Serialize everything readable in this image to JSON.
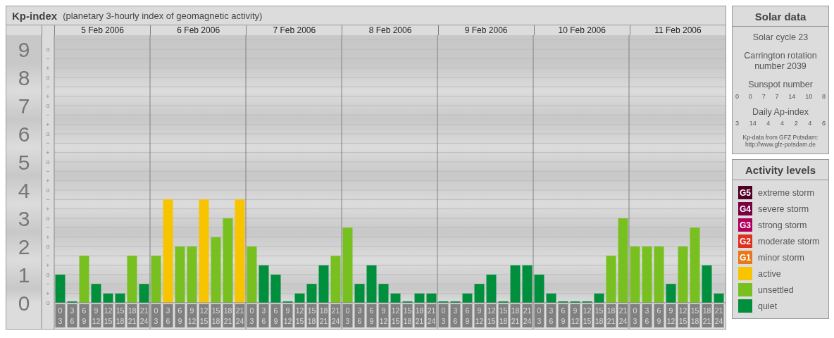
{
  "kp_panel": {
    "title": "Kp-index",
    "subtitle": "(planetary 3-hourly index of geomagnetic activity)",
    "days": [
      "5 Feb 2006",
      "6 Feb 2006",
      "7 Feb 2006",
      "8 Feb 2006",
      "9 Feb 2006",
      "10 Feb 2006",
      "11 Feb 2006"
    ],
    "sub_ticks": [
      "o",
      "−",
      "+",
      "o",
      "−",
      "+",
      "o",
      "−",
      "+",
      "o",
      "−",
      "+",
      "o",
      "−",
      "+",
      "o",
      "−",
      "+",
      "o",
      "−",
      "+",
      "o",
      "−",
      "+",
      "o",
      "−",
      "+",
      "o"
    ],
    "chart_data": {
      "type": "bar",
      "grid": true,
      "categories": [
        "0 3",
        "3 6",
        "6 9",
        "9 12",
        "12 15",
        "15 18",
        "18 21",
        "21 24",
        "0 3",
        "3 6",
        "6 9",
        "9 12",
        "12 15",
        "15 18",
        "18 21",
        "21 24",
        "0 3",
        "3 6",
        "6 9",
        "9 12",
        "12 15",
        "15 18",
        "18 21",
        "21 24",
        "0 3",
        "3 6",
        "6 9",
        "9 12",
        "12 15",
        "15 18",
        "18 21",
        "21 24",
        "0 3",
        "3 6",
        "6 9",
        "9 12",
        "12 15",
        "15 18",
        "18 21",
        "21 24",
        "0 3",
        "3 6",
        "6 9",
        "9 12",
        "12 15",
        "15 18",
        "18 21",
        "21 24",
        "0 3",
        "3 6",
        "6 9",
        "9 12",
        "12 15",
        "15 18",
        "18 21",
        "21 24"
      ],
      "ylim": [
        0,
        9.5
      ],
      "yticks": [
        0,
        1,
        2,
        3,
        4,
        5,
        6,
        7,
        8,
        9
      ],
      "series": [
        {
          "color": "#008f3c",
          "values": [
            1,
            0,
            null,
            0.67,
            0.33,
            0.33,
            null,
            0.67,
            null,
            null,
            null,
            null,
            null,
            null,
            null,
            null,
            null,
            1.33,
            1,
            0,
            0.33,
            0.67,
            1.33,
            null,
            null,
            0.67,
            1.33,
            0.67,
            0.33,
            0,
            0.33,
            0.33,
            0,
            0,
            0.33,
            0.67,
            1,
            0,
            1.33,
            1.33,
            1,
            0.33,
            0,
            0,
            0,
            0.33,
            null,
            null,
            null,
            null,
            null,
            0.67,
            null,
            null,
            1.33,
            0.33
          ]
        },
        {
          "color": "#78c020",
          "values": [
            null,
            null,
            1.67,
            null,
            null,
            null,
            1.67,
            null,
            1.67,
            null,
            2,
            2,
            null,
            2.33,
            3,
            null,
            2,
            null,
            null,
            null,
            null,
            null,
            null,
            1.67,
            2.67,
            null,
            null,
            null,
            null,
            null,
            null,
            null,
            null,
            null,
            null,
            null,
            null,
            null,
            null,
            null,
            null,
            null,
            null,
            null,
            null,
            null,
            1.67,
            3,
            2,
            2,
            2,
            null,
            2,
            2.67,
            null,
            null
          ]
        },
        {
          "color": "#f8c400",
          "values": [
            null,
            null,
            null,
            null,
            null,
            null,
            null,
            null,
            null,
            3.67,
            null,
            null,
            3.67,
            null,
            null,
            3.67,
            null,
            null,
            null,
            null,
            null,
            null,
            null,
            null,
            null,
            null,
            null,
            null,
            null,
            null,
            null,
            null,
            null,
            null,
            null,
            null,
            null,
            null,
            null,
            null,
            null,
            null,
            null,
            null,
            null,
            null,
            null,
            null,
            null,
            null,
            null,
            null,
            null,
            null,
            null,
            null
          ]
        }
      ]
    }
  },
  "solar_data": {
    "title": "Solar data",
    "cycle": "Solar cycle 23",
    "rotation": "Carrington rotation number 2039",
    "sunspot_label": "Sunspot number",
    "sunspot_numbers": [
      "0",
      "0",
      "7",
      "7",
      "14",
      "10",
      "8"
    ],
    "ap_label": "Daily Ap-index",
    "ap_values": [
      "3",
      "14",
      "4",
      "4",
      "2",
      "4",
      "6"
    ],
    "credit": "Kp-data from GFZ Potsdam:",
    "credit_url": "http://www.gfz-potsdam.de"
  },
  "activity_levels": {
    "title": "Activity levels",
    "items": [
      {
        "code": "G5",
        "label": "extreme storm",
        "color": "#500024"
      },
      {
        "code": "G4",
        "label": "severe storm",
        "color": "#780040"
      },
      {
        "code": "G3",
        "label": "strong storm",
        "color": "#b0005c"
      },
      {
        "code": "G2",
        "label": "moderate storm",
        "color": "#e03020"
      },
      {
        "code": "G1",
        "label": "minor storm",
        "color": "#e87818"
      },
      {
        "label": "active",
        "color": "#f8c400"
      },
      {
        "label": "unsettled",
        "color": "#78c020"
      },
      {
        "label": "quiet",
        "color": "#008f3c"
      }
    ]
  }
}
